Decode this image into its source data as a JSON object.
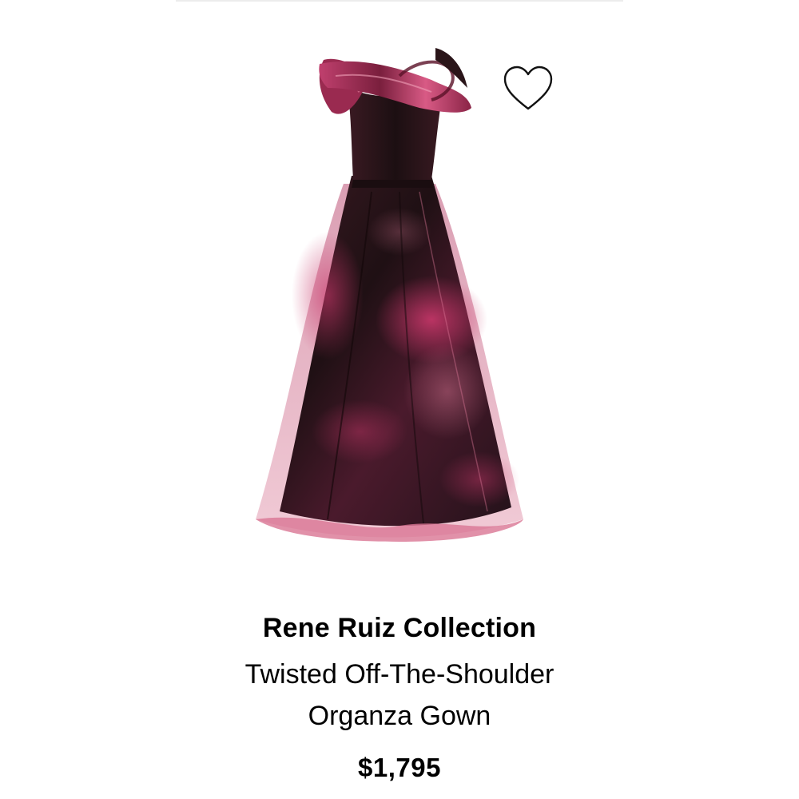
{
  "product": {
    "brand": "Rene Ruiz Collection",
    "name_line1": "Twisted Off-The-Shoulder",
    "name_line2": "Organza Gown",
    "price": "$1,795",
    "image_icon": "gown-photo",
    "wishlist_icon": "heart-outline-icon"
  },
  "colors": {
    "gown_dark": "#2a1519",
    "gown_magenta": "#b0305c",
    "gown_rose": "#d97593",
    "text": "#000000",
    "divider": "#ececec"
  }
}
